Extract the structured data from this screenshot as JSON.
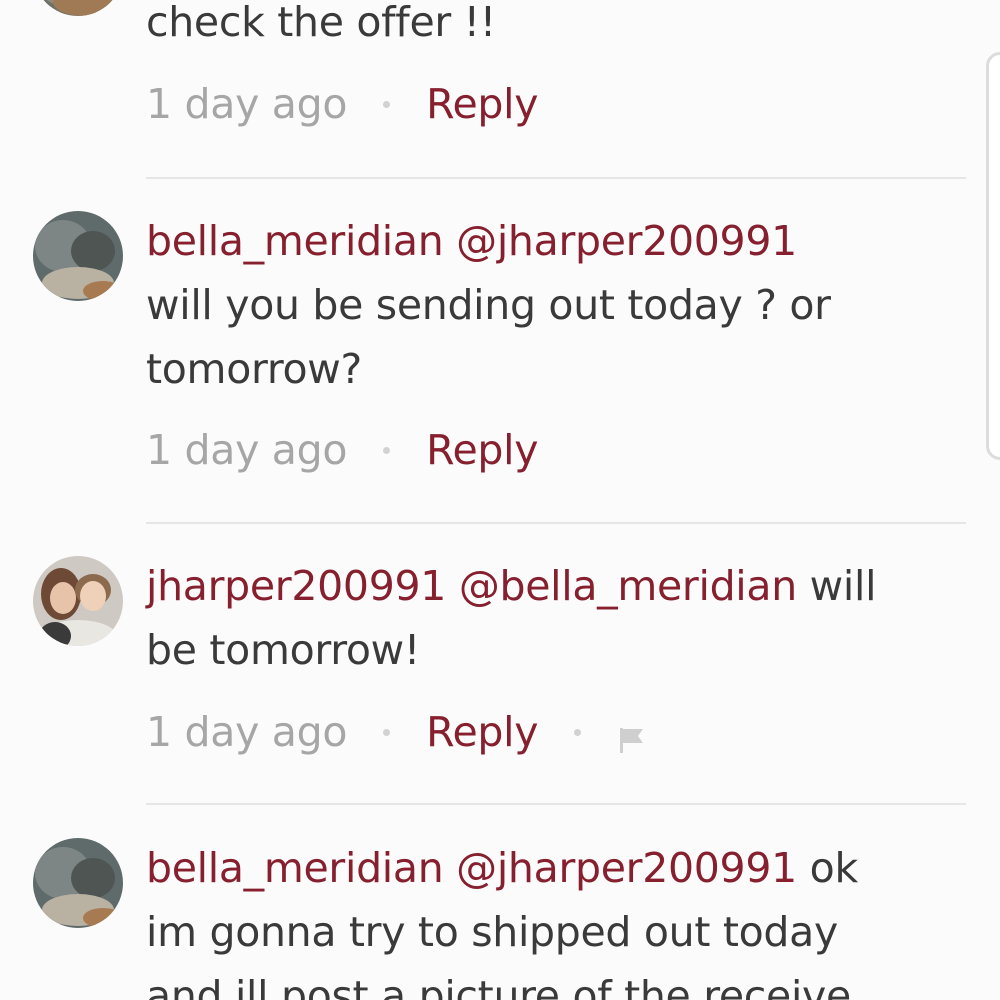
{
  "comments": [
    {
      "text": "check the offer !!",
      "time": "1 day ago",
      "reply_label": "Reply"
    },
    {
      "username": "bella_meridian",
      "mention": "@jharper200991",
      "text_line1": "will you be sending out today ? or",
      "text_line2": "tomorrow?",
      "time": "1 day ago",
      "reply_label": "Reply"
    },
    {
      "username": "jharper200991",
      "mention": "@bella_meridian",
      "text_inline": "will",
      "text_line2": "be tomorrow!",
      "time": "1 day ago",
      "reply_label": "Reply",
      "flag_icon": "flag-icon"
    },
    {
      "username": "bella_meridian",
      "mention": "@jharper200991",
      "text_inline": "ok",
      "text_line2": "im gonna try to shipped out today",
      "text_line3": "and ill post a picture of the receive"
    }
  ],
  "colors": {
    "accent": "#86202e",
    "text": "#3a3a3a",
    "muted": "#a6a6a6",
    "background": "#fbfbfb"
  }
}
